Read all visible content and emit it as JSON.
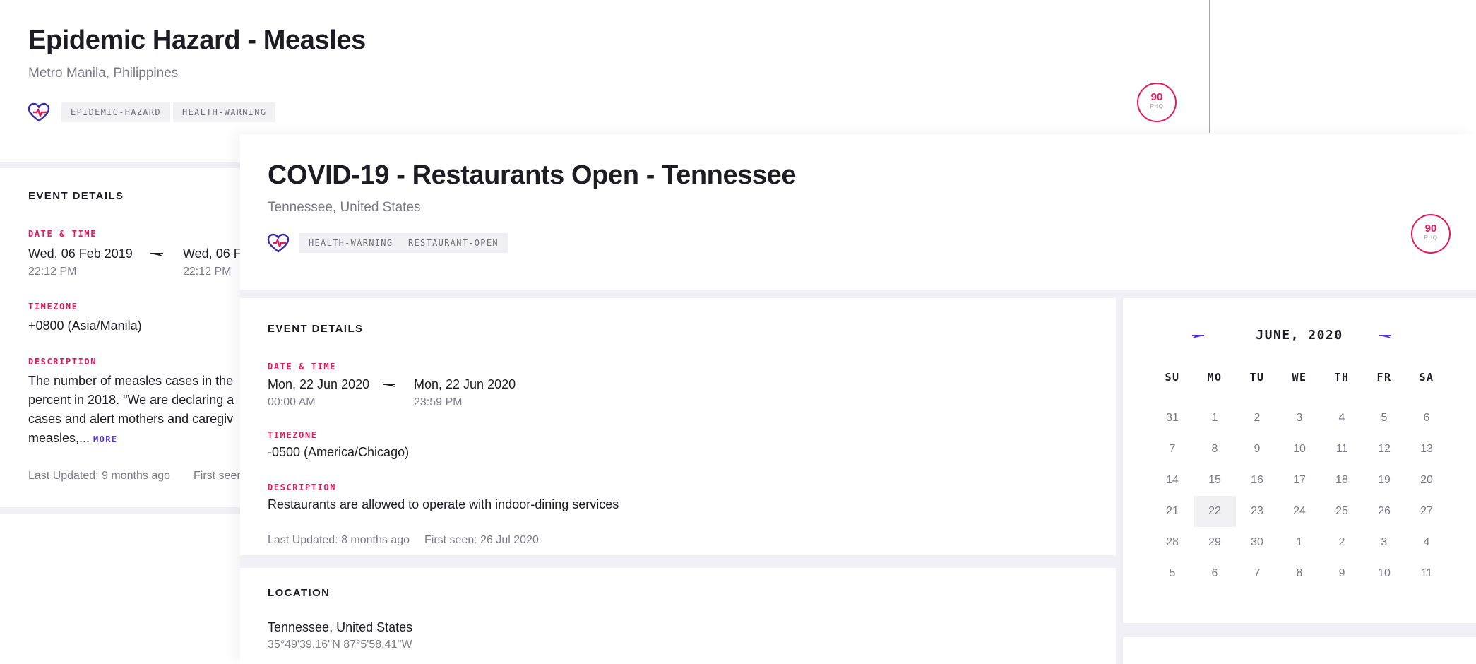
{
  "back_event": {
    "title": "Epidemic Hazard - Measles",
    "location": "Metro Manila, Philippines",
    "tags": [
      "EPIDEMIC-HAZARD",
      "HEALTH-WARNING"
    ],
    "phq": {
      "score": "90",
      "label": "PHQ"
    },
    "details": {
      "heading": "EVENT DETAILS",
      "datetime_label": "DATE & TIME",
      "start_date": "Wed, 06 Feb 2019",
      "start_time": "22:12 PM",
      "end_date": "Wed, 06 F",
      "end_time": "22:12 PM",
      "timezone_label": "TIMEZONE",
      "timezone": "+0800 (Asia/Manila)",
      "description_label": "DESCRIPTION",
      "description_lines": [
        "The number of measles cases in the",
        "percent in 2018. \"We are declaring a",
        "cases and alert mothers and caregiv",
        "measles,..."
      ],
      "more": "MORE",
      "last_updated": "Last Updated: 9 months ago",
      "first_seen": "First seen"
    }
  },
  "front_event": {
    "title": "COVID-19 - Restaurants Open - Tennessee",
    "location": "Tennessee, United States",
    "tags": [
      "HEALTH-WARNING",
      "RESTAURANT-OPEN"
    ],
    "phq": {
      "score": "90",
      "label": "PHQ"
    },
    "details": {
      "heading": "EVENT DETAILS",
      "datetime_label": "DATE & TIME",
      "start_date": "Mon, 22 Jun 2020",
      "start_time": "00:00 AM",
      "end_date": "Mon, 22 Jun 2020",
      "end_time": "23:59 PM",
      "timezone_label": "TIMEZONE",
      "timezone": "-0500 (America/Chicago)",
      "description_label": "DESCRIPTION",
      "description": "Restaurants are allowed to operate with indoor-dining services",
      "last_updated": "Last Updated: 8 months ago",
      "first_seen": "First seen: 26 Jul 2020"
    },
    "location_section": {
      "heading": "LOCATION",
      "place": "Tennessee, United States",
      "coordinates": "35°49'39.16''N 87°5'58.41''W"
    },
    "calendar": {
      "month": "JUNE, 2020",
      "weekdays": [
        "SU",
        "MO",
        "TU",
        "WE",
        "TH",
        "FR",
        "SA"
      ],
      "weeks": [
        [
          "31",
          "1",
          "2",
          "3",
          "4",
          "5",
          "6"
        ],
        [
          "7",
          "8",
          "9",
          "10",
          "11",
          "12",
          "13"
        ],
        [
          "14",
          "15",
          "16",
          "17",
          "18",
          "19",
          "20"
        ],
        [
          "21",
          "22",
          "23",
          "24",
          "25",
          "26",
          "27"
        ],
        [
          "28",
          "29",
          "30",
          "1",
          "2",
          "3",
          "4"
        ],
        [
          "5",
          "6",
          "7",
          "8",
          "9",
          "10",
          "11"
        ]
      ],
      "selected_day": "22",
      "accent_color": "#5533dd"
    }
  },
  "colors": {
    "brand_pink": "#e8175d",
    "link_purple": "#5533dd",
    "muted": "#7b7b85",
    "band": "#f1f0f4"
  },
  "icons": [
    "heart-pulse-icon",
    "arrow-right-icon",
    "chevron-left-icon",
    "chevron-right-icon"
  ]
}
